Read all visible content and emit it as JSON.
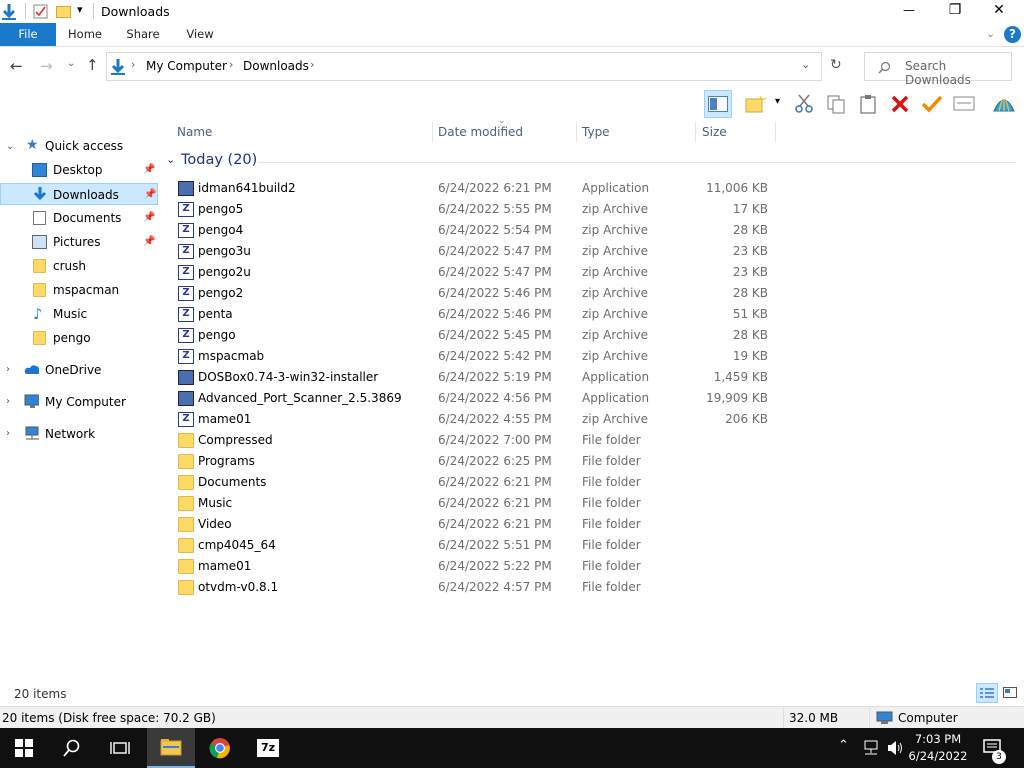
{
  "window": {
    "title": "Downloads",
    "controls": {
      "minimize": "—",
      "maximize": "❐",
      "close": "✕"
    }
  },
  "ribbon": {
    "tabs": [
      {
        "label": "File"
      },
      {
        "label": "Home"
      },
      {
        "label": "Share"
      },
      {
        "label": "View"
      }
    ]
  },
  "address": {
    "crumbs": [
      "My Computer",
      "Downloads"
    ],
    "search_placeholder": "Search Downloads"
  },
  "nav": {
    "quick_access": "Quick access",
    "items": [
      {
        "label": "Desktop",
        "pinned": true
      },
      {
        "label": "Downloads",
        "pinned": true,
        "selected": true
      },
      {
        "label": "Documents",
        "pinned": true
      },
      {
        "label": "Pictures",
        "pinned": true
      },
      {
        "label": "crush"
      },
      {
        "label": "mspacman"
      },
      {
        "label": "Music"
      },
      {
        "label": "pengo"
      }
    ],
    "roots": [
      {
        "label": "OneDrive"
      },
      {
        "label": "My Computer"
      },
      {
        "label": "Network"
      }
    ]
  },
  "columns": {
    "name": "Name",
    "date": "Date modified",
    "type": "Type",
    "size": "Size"
  },
  "group": {
    "label": "Today (20)"
  },
  "files": [
    {
      "name": "idman641build2",
      "date": "6/24/2022 6:21 PM",
      "type": "Application",
      "size": "11,006 KB",
      "icon": "app-icon"
    },
    {
      "name": "pengo5",
      "date": "6/24/2022 5:55 PM",
      "type": "zip Archive",
      "size": "17 KB",
      "icon": "zip-icon"
    },
    {
      "name": "pengo4",
      "date": "6/24/2022 5:54 PM",
      "type": "zip Archive",
      "size": "28 KB",
      "icon": "zip-icon"
    },
    {
      "name": "pengo3u",
      "date": "6/24/2022 5:47 PM",
      "type": "zip Archive",
      "size": "23 KB",
      "icon": "zip-icon"
    },
    {
      "name": "pengo2u",
      "date": "6/24/2022 5:47 PM",
      "type": "zip Archive",
      "size": "23 KB",
      "icon": "zip-icon"
    },
    {
      "name": "pengo2",
      "date": "6/24/2022 5:46 PM",
      "type": "zip Archive",
      "size": "28 KB",
      "icon": "zip-icon"
    },
    {
      "name": "penta",
      "date": "6/24/2022 5:46 PM",
      "type": "zip Archive",
      "size": "51 KB",
      "icon": "zip-icon"
    },
    {
      "name": "pengo",
      "date": "6/24/2022 5:45 PM",
      "type": "zip Archive",
      "size": "28 KB",
      "icon": "zip-icon"
    },
    {
      "name": "mspacmab",
      "date": "6/24/2022 5:42 PM",
      "type": "zip Archive",
      "size": "19 KB",
      "icon": "zip-icon"
    },
    {
      "name": "DOSBox0.74-3-win32-installer",
      "date": "6/24/2022 5:19 PM",
      "type": "Application",
      "size": "1,459 KB",
      "icon": "app-icon"
    },
    {
      "name": "Advanced_Port_Scanner_2.5.3869",
      "date": "6/24/2022 4:56 PM",
      "type": "Application",
      "size": "19,909 KB",
      "icon": "app-icon"
    },
    {
      "name": "mame01",
      "date": "6/24/2022 4:55 PM",
      "type": "zip Archive",
      "size": "206 KB",
      "icon": "zip-icon"
    },
    {
      "name": "Compressed",
      "date": "6/24/2022 7:00 PM",
      "type": "File folder",
      "size": "",
      "icon": "folder-icon"
    },
    {
      "name": "Programs",
      "date": "6/24/2022 6:25 PM",
      "type": "File folder",
      "size": "",
      "icon": "folder-icon"
    },
    {
      "name": "Documents",
      "date": "6/24/2022 6:21 PM",
      "type": "File folder",
      "size": "",
      "icon": "folder-icon"
    },
    {
      "name": "Music",
      "date": "6/24/2022 6:21 PM",
      "type": "File folder",
      "size": "",
      "icon": "folder-icon"
    },
    {
      "name": "Video",
      "date": "6/24/2022 6:21 PM",
      "type": "File folder",
      "size": "",
      "icon": "folder-icon"
    },
    {
      "name": "cmp4045_64",
      "date": "6/24/2022 5:51 PM",
      "type": "File folder",
      "size": "",
      "icon": "folder-icon"
    },
    {
      "name": "mame01",
      "date": "6/24/2022 5:22 PM",
      "type": "File folder",
      "size": "",
      "icon": "folder-icon"
    },
    {
      "name": "otvdm-v0.8.1",
      "date": "6/24/2022 4:57 PM",
      "type": "File folder",
      "size": "",
      "icon": "folder-icon"
    }
  ],
  "status": {
    "item_count": "20 items",
    "disk_info": "20 items (Disk free space: 70.2 GB)",
    "selection_size": "32.0 MB",
    "location": "Computer"
  },
  "taskbar": {
    "time": "7:03 PM",
    "date": "6/24/2022",
    "notification_count": "3"
  },
  "colors": {
    "accent": "#1979ca",
    "selection": "#cce8ff",
    "group_text": "#1e3287",
    "taskbar": "#101010"
  }
}
